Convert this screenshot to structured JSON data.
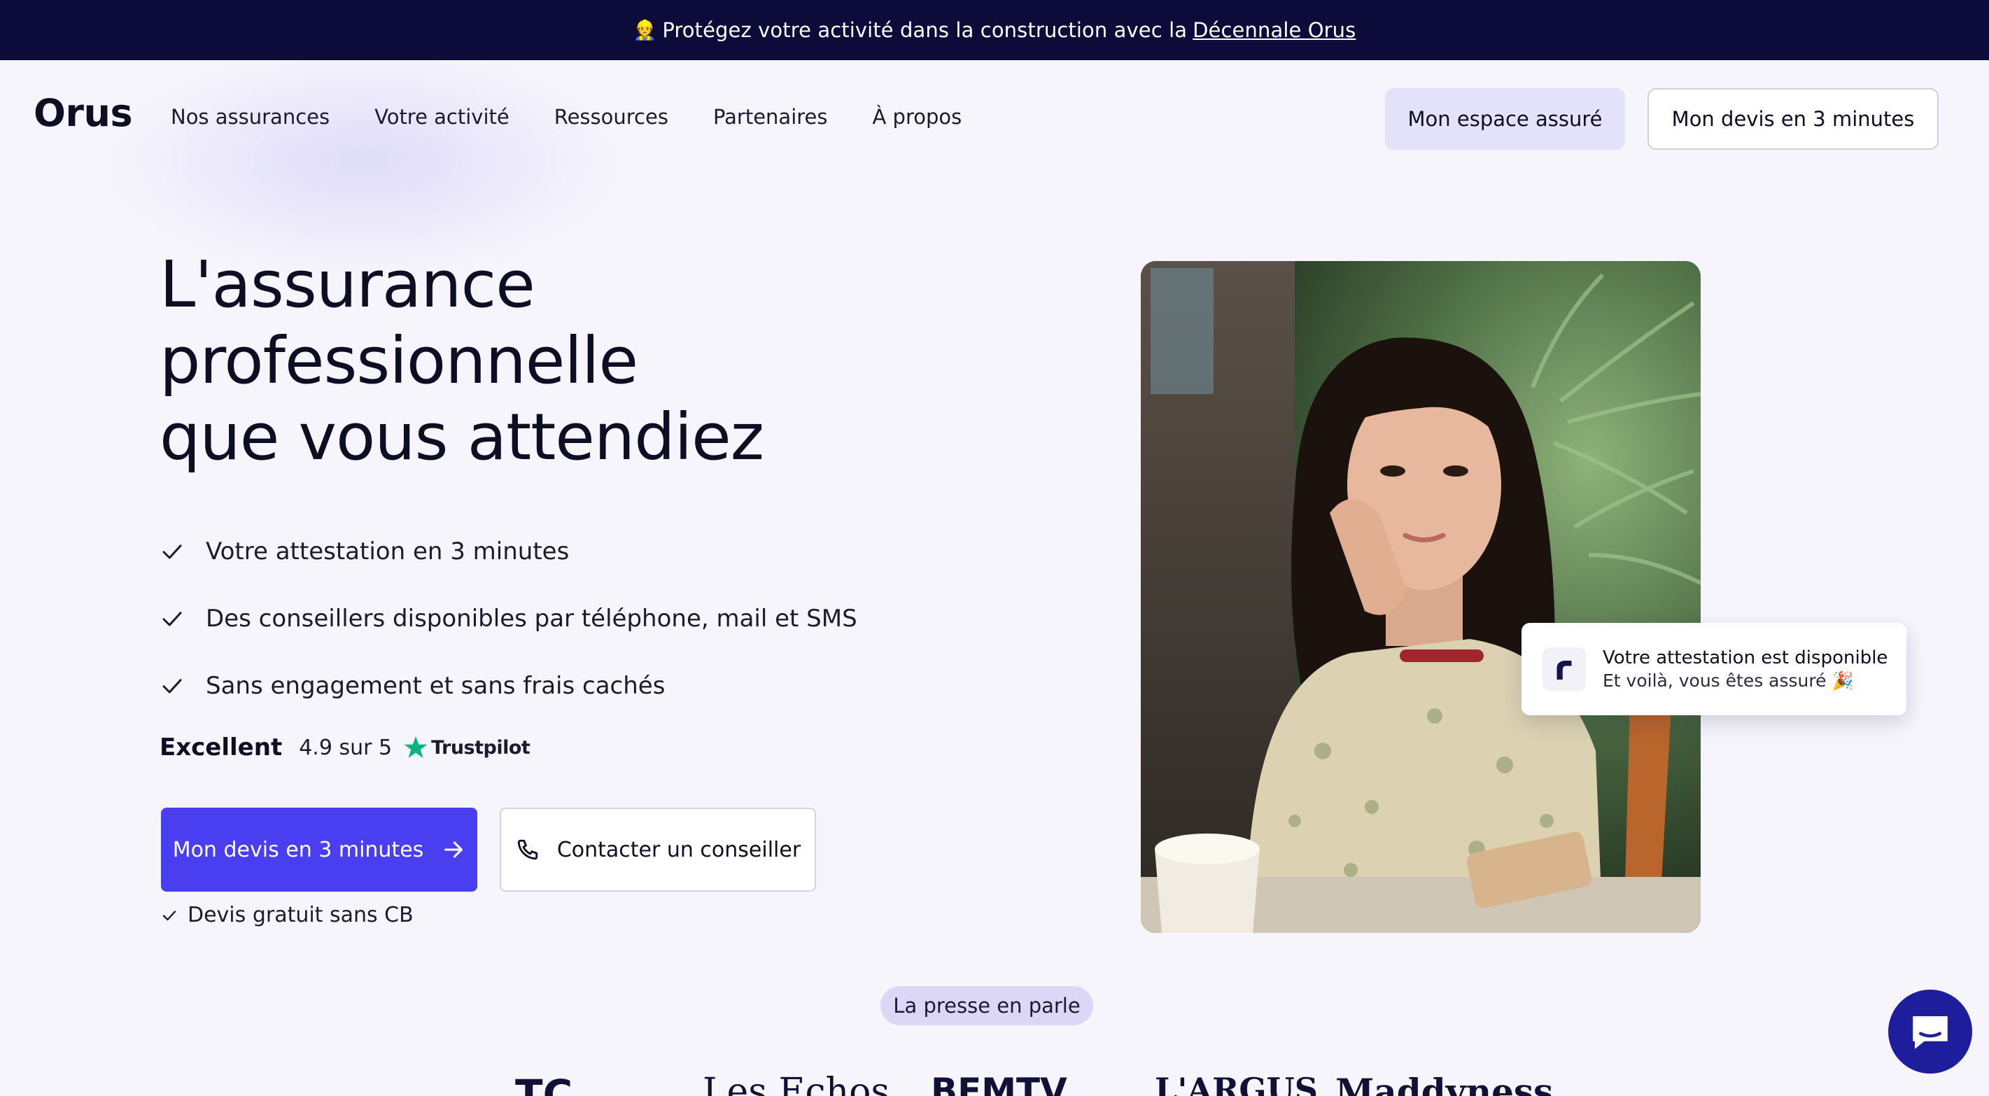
{
  "banner": {
    "emoji": "👷",
    "text": "Protégez votre activité dans la construction avec la",
    "link": "Décennale Orus"
  },
  "nav": {
    "logo": "Orus",
    "items": [
      "Nos assurances",
      "Votre activité",
      "Ressources",
      "Partenaires",
      "À propos"
    ],
    "espace_label": "Mon espace assuré",
    "devis_label": "Mon devis en 3 minutes"
  },
  "hero": {
    "title_lines": [
      "L'assurance",
      "professionnelle",
      "que vous attendiez"
    ],
    "benefits": [
      "Votre attestation en 3 minutes",
      "Des conseillers disponibles par téléphone, mail et SMS",
      "Sans engagement et sans frais cachés"
    ],
    "rating": {
      "label": "Excellent",
      "score": "4.9 sur 5",
      "provider": "Trustpilot"
    },
    "cta_primary": "Mon devis en 3 minutes",
    "cta_secondary": "Contacter un conseiller",
    "note": "Devis gratuit sans CB"
  },
  "notification": {
    "title": "Votre attestation est disponible",
    "subtitle": "Et voilà, vous êtes assuré 🎉"
  },
  "press": {
    "label": "La presse en parle",
    "logos": [
      "TC",
      "Les Echos",
      "BFMTV",
      "L'ARGUS",
      "Maddyness"
    ]
  },
  "colors": {
    "banner_bg": "#0c0b3a",
    "primary": "#4a3ff0",
    "espace_bg": "#e4e1fb",
    "press_pill": "#dcd7f7",
    "trustpilot_green": "#00b67a",
    "chat_bg": "#1e1e9c"
  },
  "icons": [
    "check-icon",
    "arrow-right-icon",
    "phone-icon",
    "trustpilot-star-icon",
    "orus-mark-icon",
    "chat-bubble-icon"
  ]
}
